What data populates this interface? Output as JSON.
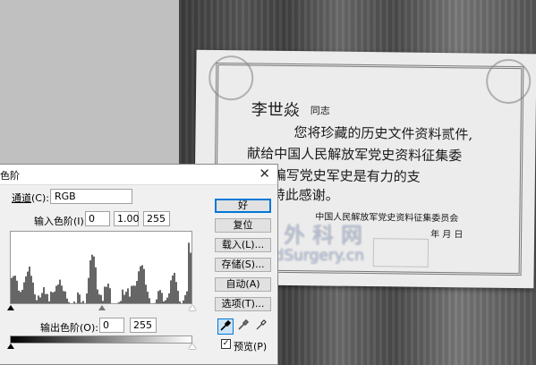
{
  "dialog": {
    "title": "色阶",
    "close_glyph": "✕",
    "channel_label": "通道",
    "channel_key": "(C):",
    "channel_value": "RGB",
    "input_levels_label": "输入色阶",
    "input_levels_key": "(I):",
    "input_black": "0",
    "input_gamma": "1.00",
    "input_white": "255",
    "output_levels_label": "输出色阶",
    "output_levels_key": "(O):",
    "output_black": "0",
    "output_white": "255",
    "buttons": {
      "ok": "好",
      "reset": "复位",
      "load": "载入(L)...",
      "save": "存储(S)...",
      "auto": "自动(A)",
      "options": "选项(T)..."
    },
    "preview_label": "预览(P)",
    "preview_checked": true
  },
  "certificate": {
    "name": "李世焱",
    "salutation": "同志",
    "line1": "您将珍藏的历史文件资料贰件,",
    "line2": "献给中国人民解放军党史资料征集委",
    "line3": ",这对编写党史军史是有力的支",
    "line4": "特此感谢。",
    "org": "中国人民解放军党史资料征集委员会",
    "date": "年 月 日"
  },
  "watermark": {
    "cn": "中华手外科网",
    "url": "www.HandSurgery.cn"
  },
  "colors": {
    "default_button_border": "#0078d7",
    "dialog_bg": "#f0f0f0"
  }
}
